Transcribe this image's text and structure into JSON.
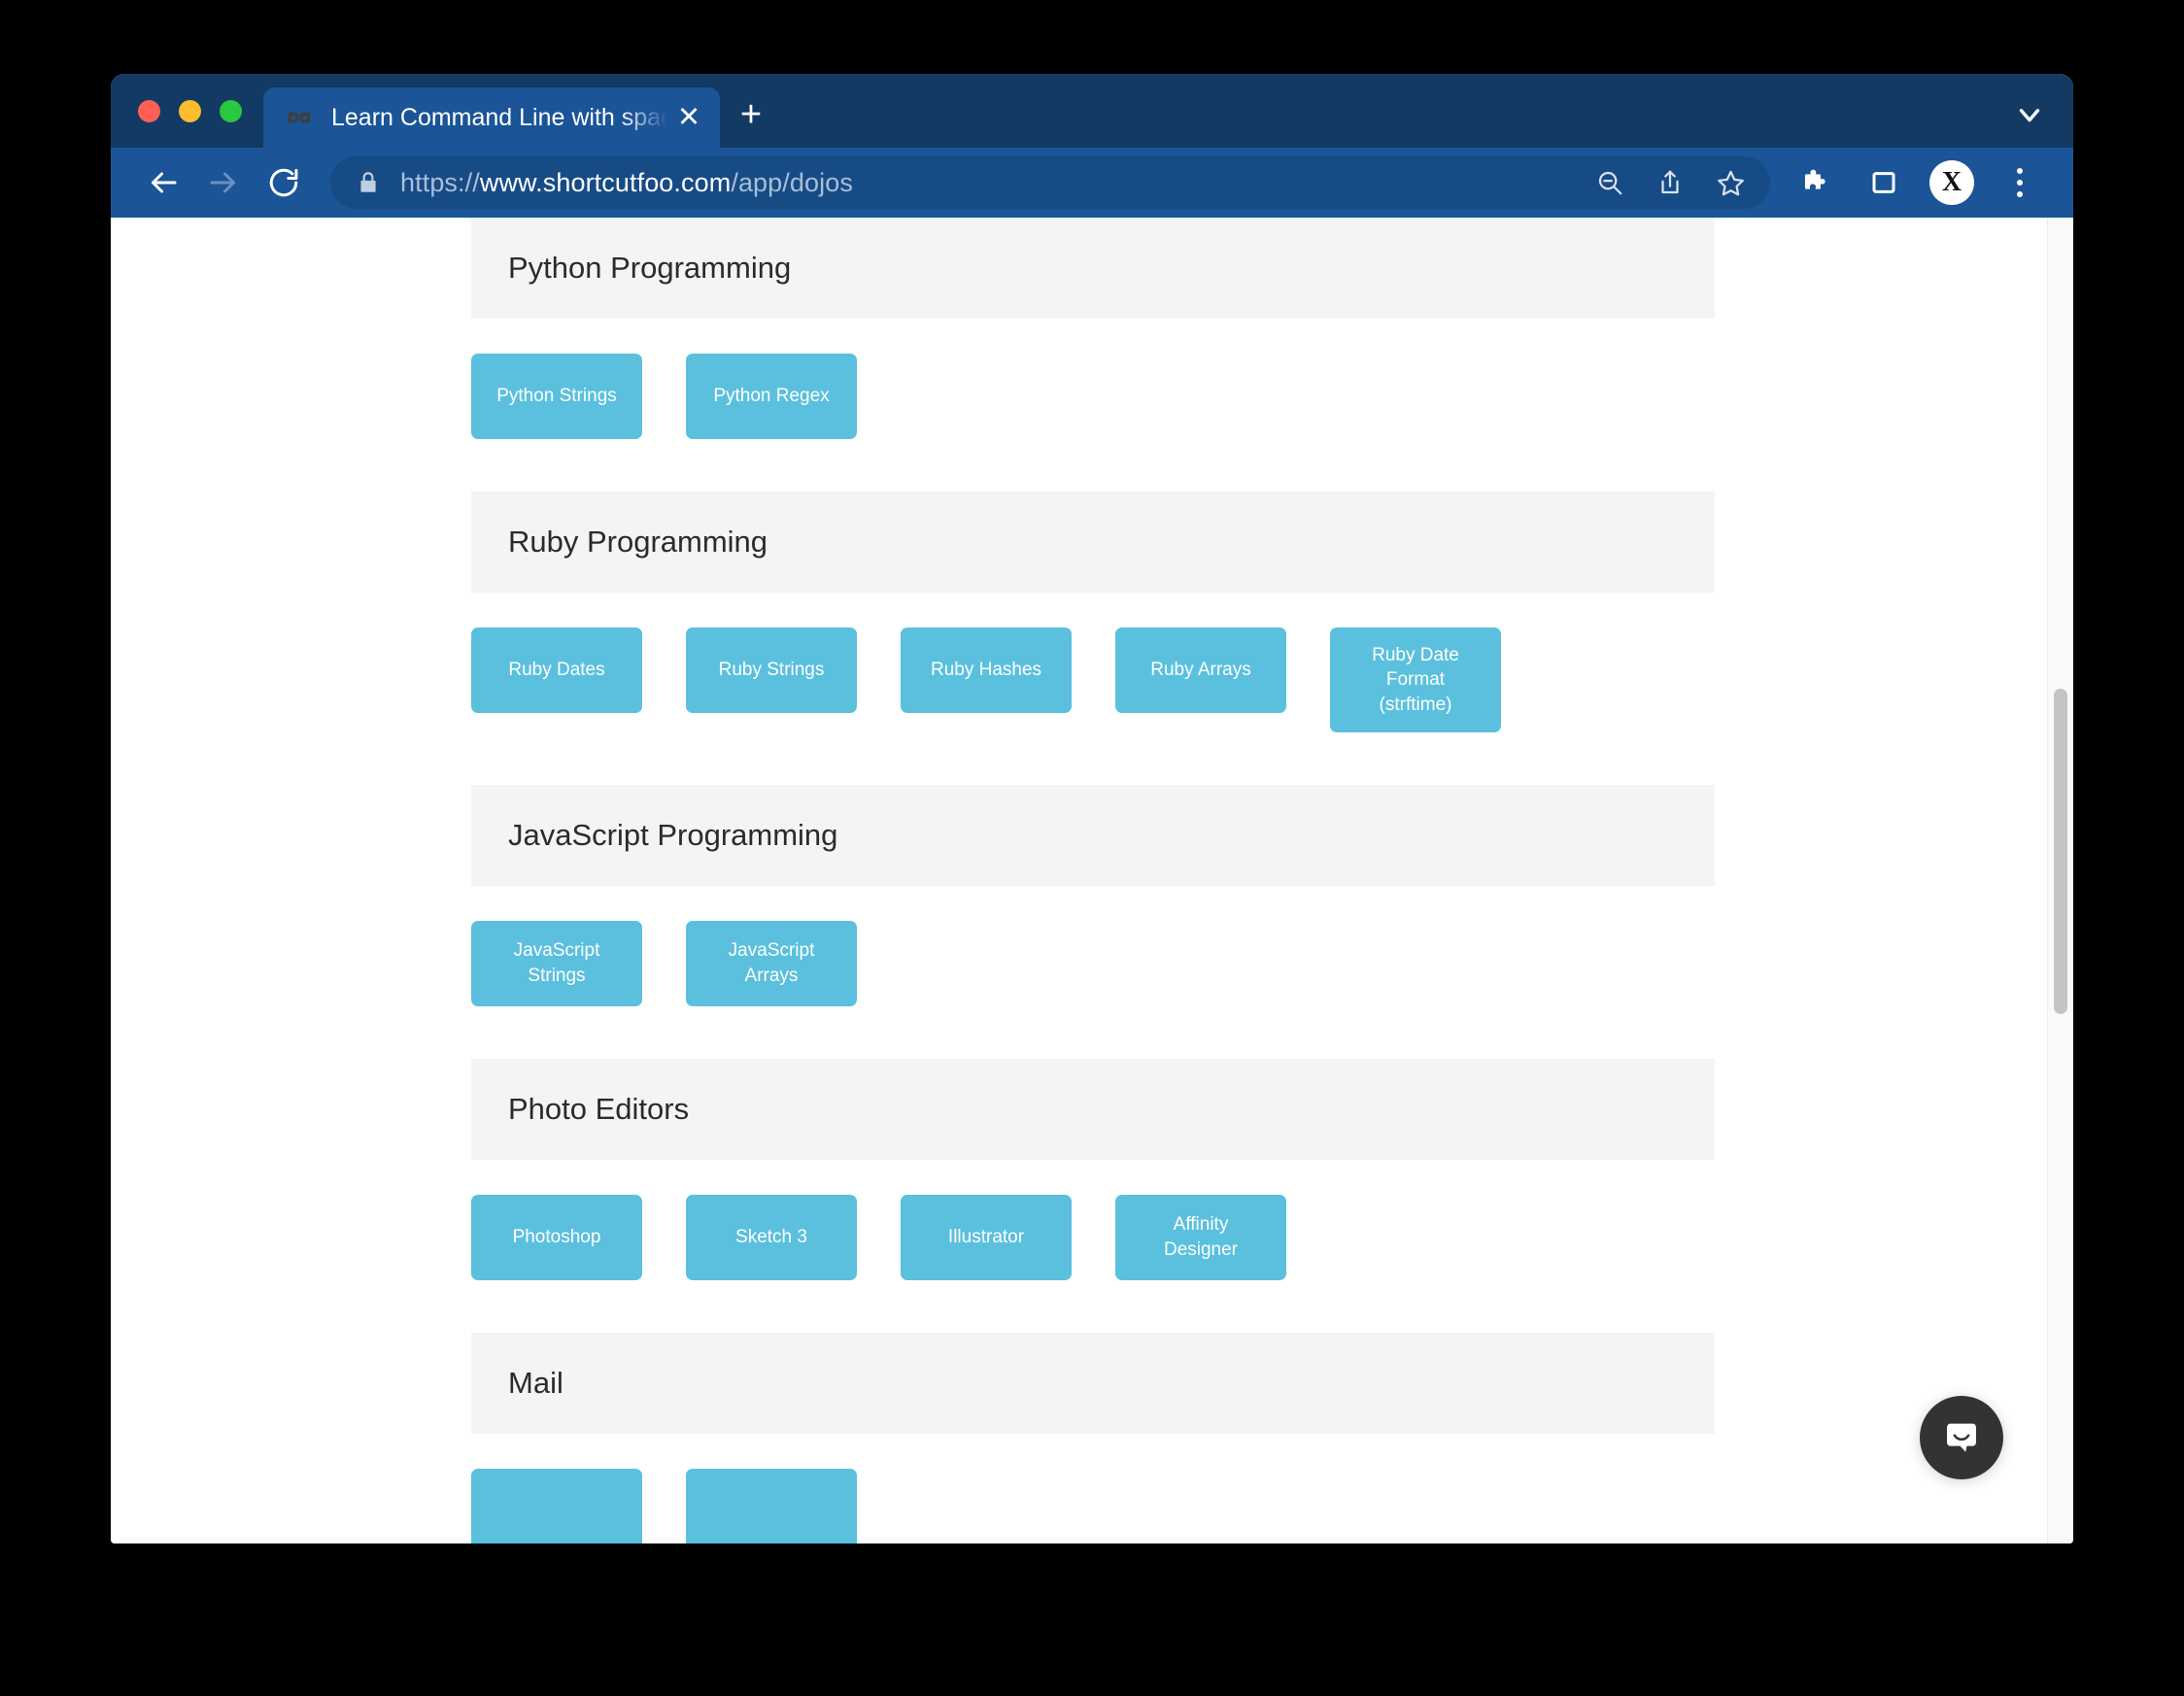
{
  "window": {
    "traffic_lights": [
      "close",
      "minimize",
      "maximize"
    ],
    "colors": {
      "chrome_dark": "#123A63",
      "chrome_blue": "#1B5497",
      "omnibox": "#174B86",
      "tile": "#5BC0DE",
      "section_header": "#F4F4F4",
      "intercom": "#333333"
    }
  },
  "tabstrip": {
    "tab": {
      "title": "Learn Command Line with spac",
      "favicon": "shortcutfoo-logo-icon",
      "close_label": "✕"
    },
    "new_tab_label": "+",
    "tab_list_chevron": "chevron-down-icon"
  },
  "toolbar": {
    "back": "←",
    "forward": "→",
    "reload": "⟳",
    "lock": "lock-icon",
    "url_full": "https://www.shortcutfoo.com/app/dojos",
    "url_scheme": "https://",
    "url_domain": "www.shortcutfoo.com",
    "url_path": "/app/dojos",
    "zoom_out_icon": "zoom-out-icon",
    "share_icon": "share-icon",
    "bookmark_icon": "star-icon",
    "extensions_icon": "puzzle-icon",
    "side_panel_icon": "side-panel-icon",
    "avatar_label": "X",
    "menu_icon": "kebab-menu-icon"
  },
  "page": {
    "sections": [
      {
        "title": "Python Programming",
        "tiles": [
          {
            "label": "Python Strings",
            "tall": false
          },
          {
            "label": "Python Regex",
            "tall": false
          }
        ]
      },
      {
        "title": "Ruby Programming",
        "tiles": [
          {
            "label": "Ruby Dates",
            "tall": false
          },
          {
            "label": "Ruby Strings",
            "tall": false
          },
          {
            "label": "Ruby Hashes",
            "tall": false
          },
          {
            "label": "Ruby Arrays",
            "tall": false
          },
          {
            "label": "Ruby Date\nFormat\n(strftime)",
            "tall": true
          }
        ]
      },
      {
        "title": "JavaScript Programming",
        "tiles": [
          {
            "label": "JavaScript\nStrings",
            "tall": false
          },
          {
            "label": "JavaScript\nArrays",
            "tall": false
          }
        ]
      },
      {
        "title": "Photo Editors",
        "tiles": [
          {
            "label": "Photoshop",
            "tall": false
          },
          {
            "label": "Sketch 3",
            "tall": false
          },
          {
            "label": "Illustrator",
            "tall": false
          },
          {
            "label": "Affinity\nDesigner",
            "tall": false
          }
        ]
      },
      {
        "title": "Mail",
        "tiles": [
          {
            "label": "",
            "tall": false
          },
          {
            "label": "",
            "tall": false
          }
        ]
      }
    ]
  },
  "widgets": {
    "intercom_icon": "chat-bubble-icon"
  }
}
